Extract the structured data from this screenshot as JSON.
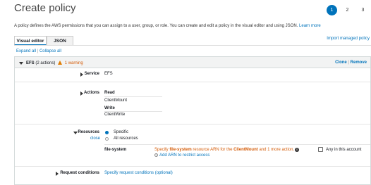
{
  "header": {
    "title": "Create policy",
    "steps": [
      "1",
      "2",
      "3"
    ]
  },
  "description": {
    "text": "A policy defines the AWS permissions that you can assign to a user, group, or role. You can create and edit a policy in the visual editor and using JSON.",
    "learn_more": "Learn more"
  },
  "tabs": [
    {
      "label": "Visual editor",
      "active": true
    },
    {
      "label": "JSON",
      "active": false
    }
  ],
  "import_link": "Import managed policy",
  "controls": {
    "expand_all": "Expand all",
    "separator": "|",
    "collapse_all": "Collapse all"
  },
  "statement": {
    "service_name": "EFS",
    "actions_count": "(2 actions)",
    "warning": "1 warning",
    "clone": "Clone",
    "separator": "|",
    "remove": "Remove",
    "service": {
      "label": "Service",
      "value": "EFS"
    },
    "actions": {
      "label": "Actions",
      "groups": [
        {
          "heading": "Read",
          "item": "ClientMount"
        },
        {
          "heading": "Write",
          "item": "ClientWrite"
        }
      ]
    },
    "resources": {
      "label": "Resources",
      "close": "close",
      "options": [
        {
          "label": "Specific",
          "selected": true
        },
        {
          "label": "All resources",
          "selected": false
        }
      ],
      "file_system": {
        "label": "file-system",
        "msg_prefix": "Specify",
        "msg_bold1": "file-system",
        "msg_middle": "resource ARN for the",
        "msg_bold2": "ClientMount",
        "msg_suffix": "and 1 more action.",
        "add_arn": "Add ARN to restrict access",
        "any_account": "Any in this account"
      }
    },
    "request_conditions": {
      "label": "Request conditions",
      "link": "Specify request conditions (optional)"
    }
  },
  "colors": {
    "accent": "#0073bb",
    "warning": "#d45b07"
  }
}
